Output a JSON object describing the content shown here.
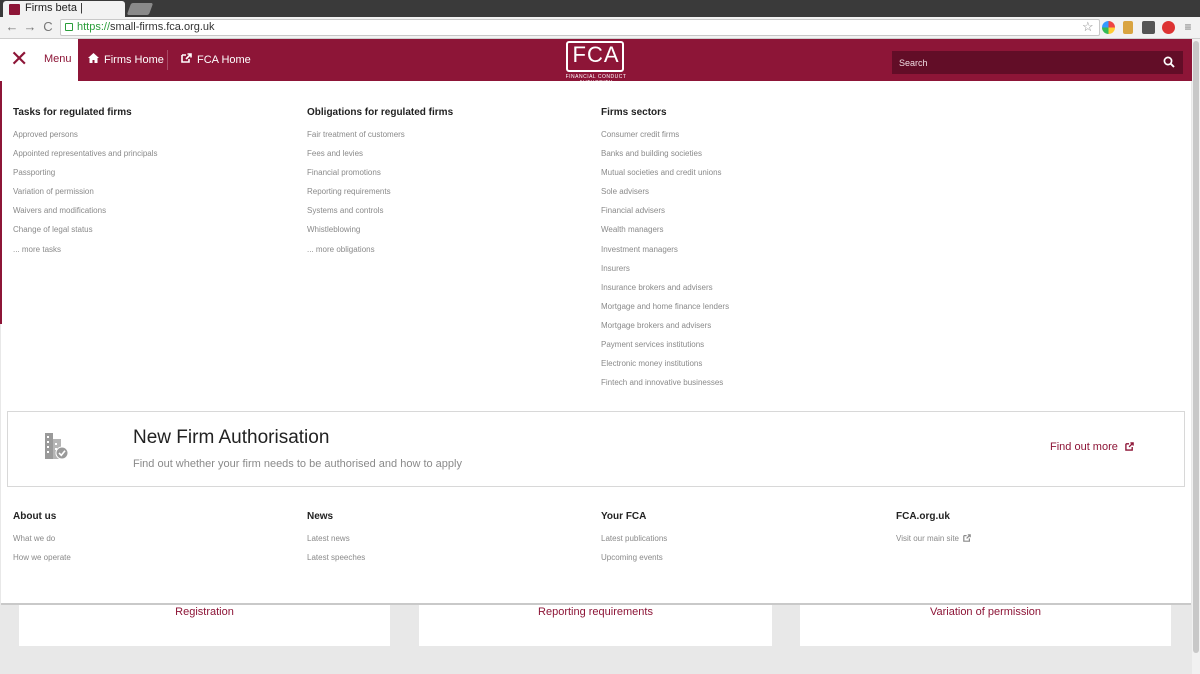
{
  "browser": {
    "tab_title": "Firms beta |",
    "url_scheme": "https://",
    "url_rest": "small-firms.fca.org.uk"
  },
  "header": {
    "menu_label": "Menu",
    "firms_home": "Firms Home",
    "fca_home": "FCA Home",
    "logo_text": "FCA",
    "logo_sub": "FINANCIAL CONDUCT AUTHORITY",
    "search_placeholder": "Search"
  },
  "mega_menu": {
    "columns": [
      {
        "title": "Tasks for regulated firms",
        "links": [
          "Approved persons",
          "Appointed representatives and principals",
          "Passporting",
          "Variation of permission",
          "Waivers and modifications",
          "Change of legal status",
          "... more tasks"
        ]
      },
      {
        "title": "Obligations for regulated firms",
        "links": [
          "Fair treatment of customers",
          "Fees and levies",
          "Financial promotions",
          "Reporting requirements",
          "Systems and controls",
          "Whistleblowing",
          "... more obligations"
        ]
      },
      {
        "title": "Firms sectors",
        "links": [
          "Consumer credit firms",
          "Banks and building societies",
          "Mutual societies and credit unions",
          "Sole advisers",
          "Financial advisers",
          "Wealth managers",
          "Investment managers",
          "Insurers",
          "Insurance brokers and advisers",
          "Mortgage and home finance lenders",
          "Mortgage brokers and advisers",
          "Payment services institutions",
          "Electronic money institutions",
          "Fintech and innovative businesses"
        ]
      }
    ],
    "authorisation": {
      "title": "New Firm Authorisation",
      "subtitle": "Find out whether your firm needs to be authorised and how to apply",
      "link": "Find out more"
    },
    "footer_columns": [
      {
        "title": "About us",
        "links": [
          "What we do",
          "How we operate"
        ]
      },
      {
        "title": "News",
        "links": [
          "Latest news",
          "Latest speeches"
        ]
      },
      {
        "title": "Your FCA",
        "links": [
          "Latest publications",
          "Upcoming events"
        ]
      },
      {
        "title": "FCA.org.uk",
        "links": [
          "Visit our main site"
        ]
      }
    ]
  },
  "background_cards": [
    "Registration",
    "Reporting requirements",
    "Variation of permission"
  ],
  "colors": {
    "brand": "#8d1537",
    "search_bg": "#620d27",
    "link_grey": "#8a8a8a"
  },
  "icons": [
    "close-icon",
    "home-icon",
    "external-link-icon",
    "search-icon",
    "building-check-icon"
  ]
}
